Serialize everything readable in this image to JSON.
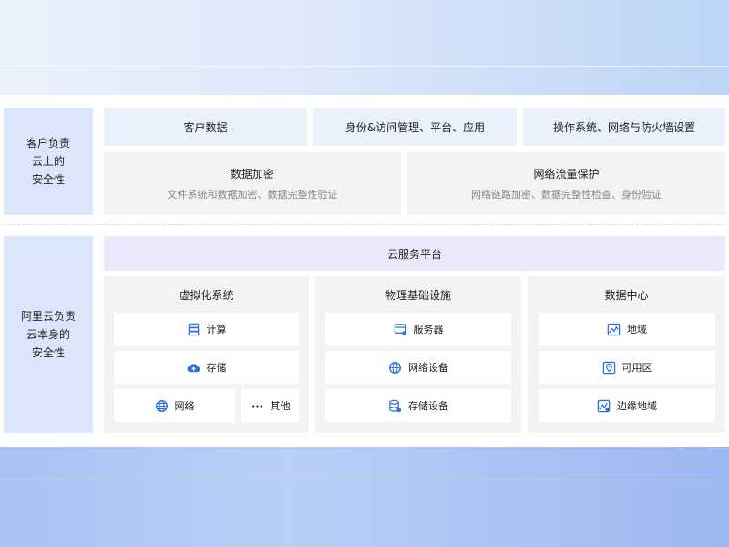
{
  "customer": {
    "label_lines": [
      "客户负责",
      "云上的",
      "安全性"
    ],
    "customer_data": "客户数据",
    "iam": "身份&访问管理、平台、应用",
    "os_network": "操作系统、网络与防火墙设置",
    "encryption": {
      "title": "数据加密",
      "desc": "文件系统和数据加密、数据完整性验证"
    },
    "traffic": {
      "title": "网络流量保护",
      "desc": "网络链路加密、数据完整性检查、身份验证"
    }
  },
  "aliyun": {
    "label_lines": [
      "阿里云负责",
      "云本身的",
      "安全性"
    ],
    "platform": "云服务平台",
    "virtualization": {
      "title": "虚拟化系统",
      "items": [
        {
          "label": "计算",
          "icon": "server-stack-icon"
        },
        {
          "label": "存储",
          "icon": "cloud-upload-icon"
        },
        {
          "label": "网络",
          "icon": "globe-icon"
        },
        {
          "label": "其他",
          "icon": "more-dots-icon"
        }
      ]
    },
    "physical": {
      "title": "物理基础设施",
      "items": [
        {
          "label": "服务器",
          "icon": "server-icon"
        },
        {
          "label": "网络设备",
          "icon": "globe-icon"
        },
        {
          "label": "存储设备",
          "icon": "database-icon"
        }
      ]
    },
    "datacenter": {
      "title": "数据中心",
      "items": [
        {
          "label": "地域",
          "icon": "region-map-icon"
        },
        {
          "label": "可用区",
          "icon": "zone-pin-icon"
        },
        {
          "label": "边缘地域",
          "icon": "edge-map-icon"
        }
      ]
    }
  },
  "colors": {
    "accent": "#2f6fe0",
    "side_bg": "#dbe6fb",
    "platform_bg": "#e9e9fb"
  }
}
